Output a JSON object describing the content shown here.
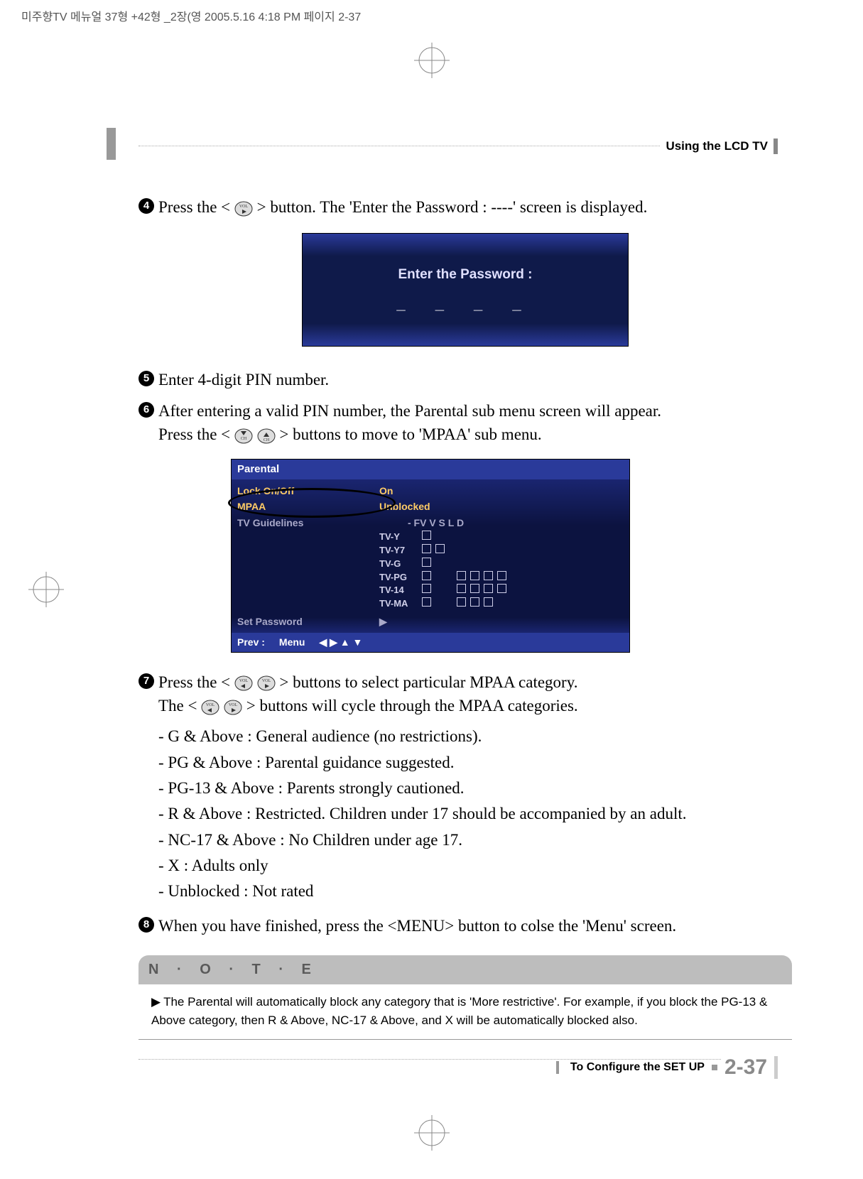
{
  "crop_header": "미주향TV 메뉴얼 37형 +42형 _2장(영  2005.5.16 4:18 PM 페이지 2-37",
  "header": "Using the LCD TV",
  "steps": {
    "s4": {
      "num": "4",
      "pre": "Press the <",
      "post": "> button. The 'Enter the Password : ----' screen is displayed."
    },
    "s5": {
      "num": "5",
      "text": "Enter 4-digit PIN number."
    },
    "s6": {
      "num": "6",
      "line1_pre": "After entering a valid PIN number, the Parental sub menu screen will appear.",
      "line2_pre": "Press the <",
      "line2_post": "> buttons to move to 'MPAA' sub menu."
    },
    "s7": {
      "num": "7",
      "line1_pre": "Press the <",
      "line1_post": "> buttons to select particular MPAA category.",
      "line2_pre": "The <",
      "line2_post": "> buttons will cycle through the MPAA categories."
    },
    "s8": {
      "num": "8",
      "text": "When you have finished, press the <MENU> button to colse the 'Menu' screen."
    }
  },
  "password_panel": {
    "title": "Enter the Password :",
    "slots": "_ _ _ _"
  },
  "parental_panel": {
    "title": "Parental",
    "rows": {
      "lock": {
        "label": "Lock On/Off",
        "value": "On"
      },
      "mpaa": {
        "label": "MPAA",
        "value": "Unblocked"
      },
      "tvg": {
        "label": "TV Guidelines",
        "value": "- FV V S L D"
      },
      "setpw": {
        "label": "Set Password",
        "value": "▶"
      }
    },
    "grid_labels": [
      "TV-Y",
      "TV-Y7",
      "TV-G",
      "TV-PG",
      "TV-14",
      "TV-MA"
    ],
    "footer": {
      "prev": "Prev :",
      "menu": "Menu",
      "arrows": "◀ ▶ ▲ ▼"
    }
  },
  "ratings": [
    "- G & Above : General audience (no restrictions).",
    "- PG & Above : Parental guidance suggested.",
    "- PG-13 & Above : Parents strongly cautioned.",
    "- R & Above : Restricted. Children under 17 should be accompanied by an adult.",
    "- NC-17 & Above : No Children under age 17.",
    "- X : Adults only",
    "- Unblocked : Not rated"
  ],
  "note": {
    "title": "N · O · T · E",
    "body": "The Parental will automatically block any category that is 'More restrictive'. For example, if you block the PG-13 & Above category, then R & Above, NC-17 & Above, and X will be automatically blocked also."
  },
  "footer": {
    "text": "To Configure the SET UP",
    "page": "2-37"
  }
}
